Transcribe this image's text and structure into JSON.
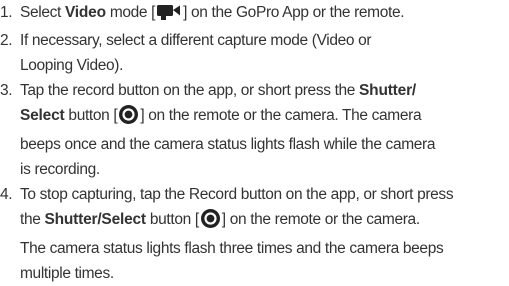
{
  "steps": [
    {
      "number": "1.",
      "pre": "Select ",
      "bold": "Video",
      "mid": " mode [",
      "icon": "video-camera-icon",
      "post": "] on the GoPro App or the remote."
    },
    {
      "number": "2.",
      "line1": "If necessary, select a different capture mode (Video or",
      "line2": "Looping Video)."
    },
    {
      "number": "3.",
      "pre": "Tap the record button on the app, or short press the ",
      "bold1": "Shutter/",
      "bold2": "Select",
      "mid": " button [",
      "icon": "shutter-button-icon",
      "post": "] on the remote or the camera. The camera",
      "line3": "beeps once and the camera status lights flash while the camera",
      "line4": "is recording."
    },
    {
      "number": "4.",
      "line1": "To stop capturing, tap the Record button on the app, or short press",
      "pre": "the ",
      "bold": "Shutter/Select",
      "mid": " button [",
      "icon": "shutter-button-icon",
      "post": "] on the remote or the camera.",
      "line3": "The camera status lights flash three times and the camera beeps",
      "line4": "multiple times."
    }
  ],
  "colors": {
    "text": "#333333",
    "icon": "#222222"
  }
}
